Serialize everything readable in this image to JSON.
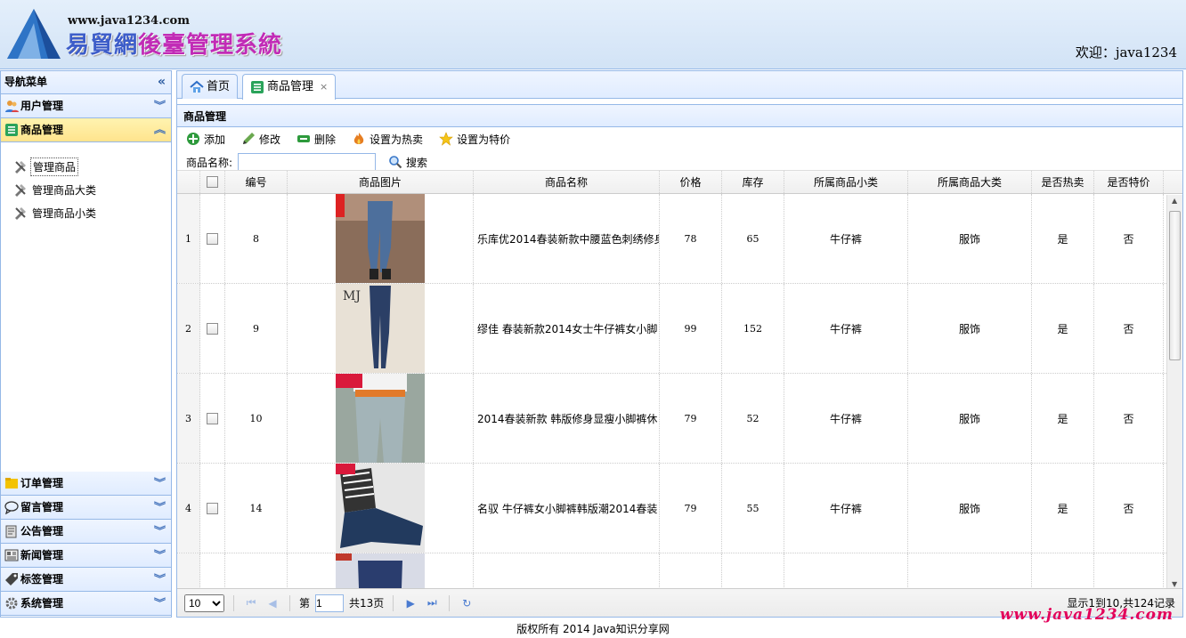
{
  "header": {
    "url": "www.java1234.com",
    "title_part1": "易貿網",
    "title_part2": "後臺管理系統",
    "welcome": "欢迎：java1234"
  },
  "nav": {
    "title": "导航菜单",
    "collapse": "«",
    "sections_top": [
      {
        "label": "用户管理",
        "icon": "users-icon"
      },
      {
        "label": "商品管理",
        "icon": "list-icon",
        "active": true
      }
    ],
    "tree": [
      {
        "label": "管理商品",
        "selected": true
      },
      {
        "label": "管理商品大类"
      },
      {
        "label": "管理商品小类"
      }
    ],
    "sections_bottom": [
      {
        "label": "订单管理",
        "icon": "folder-icon"
      },
      {
        "label": "留言管理",
        "icon": "comment-icon"
      },
      {
        "label": "公告管理",
        "icon": "notice-icon"
      },
      {
        "label": "新闻管理",
        "icon": "news-icon"
      },
      {
        "label": "标签管理",
        "icon": "tag-icon"
      },
      {
        "label": "系统管理",
        "icon": "gear-icon"
      }
    ]
  },
  "tabs": [
    {
      "label": "首页",
      "icon": "home-icon"
    },
    {
      "label": "商品管理",
      "icon": "list-icon",
      "closable": true,
      "active": true
    }
  ],
  "panel": {
    "title": "商品管理",
    "toolbar": {
      "add": "添加",
      "edit": "修改",
      "delete": "删除",
      "set_hot": "设置为热卖",
      "set_special": "设置为特价"
    },
    "search": {
      "label": "商品名称:",
      "value": "",
      "button": "搜索"
    }
  },
  "grid": {
    "columns": [
      "编号",
      "商品图片",
      "商品名称",
      "价格",
      "库存",
      "所属商品小类",
      "所属商品大类",
      "是否热卖",
      "是否特价"
    ],
    "rows": [
      {
        "rn": "1",
        "id": "8",
        "name": "乐库优2014春装新款中腰蓝色刺绣修身",
        "price": "78",
        "stock": "65",
        "sub": "牛仔裤",
        "big": "服饰",
        "hot": "是",
        "special": "否"
      },
      {
        "rn": "2",
        "id": "9",
        "name": "缪佳 春装新款2014女士牛仔裤女小脚",
        "price": "99",
        "stock": "152",
        "sub": "牛仔裤",
        "big": "服饰",
        "hot": "是",
        "special": "否"
      },
      {
        "rn": "3",
        "id": "10",
        "name": "2014春装新款 韩版修身显瘦小脚裤休",
        "price": "79",
        "stock": "52",
        "sub": "牛仔裤",
        "big": "服饰",
        "hot": "是",
        "special": "否"
      },
      {
        "rn": "4",
        "id": "14",
        "name": "名驭 牛仔裤女小脚裤韩版潮2014春装",
        "price": "79",
        "stock": "55",
        "sub": "牛仔裤",
        "big": "服饰",
        "hot": "是",
        "special": "否"
      },
      {
        "rn": "",
        "id": "",
        "name": "",
        "price": "",
        "stock": "",
        "sub": "",
        "big": "",
        "hot": "",
        "special": ""
      }
    ]
  },
  "pager": {
    "page_size": "10",
    "page_prefix": "第",
    "page_value": "1",
    "page_total": "共13页",
    "info": "显示1到10,共124记录"
  },
  "footer": {
    "copyright": "版权所有 2014 Java知识分享网",
    "watermark": "www.java1234.com"
  }
}
